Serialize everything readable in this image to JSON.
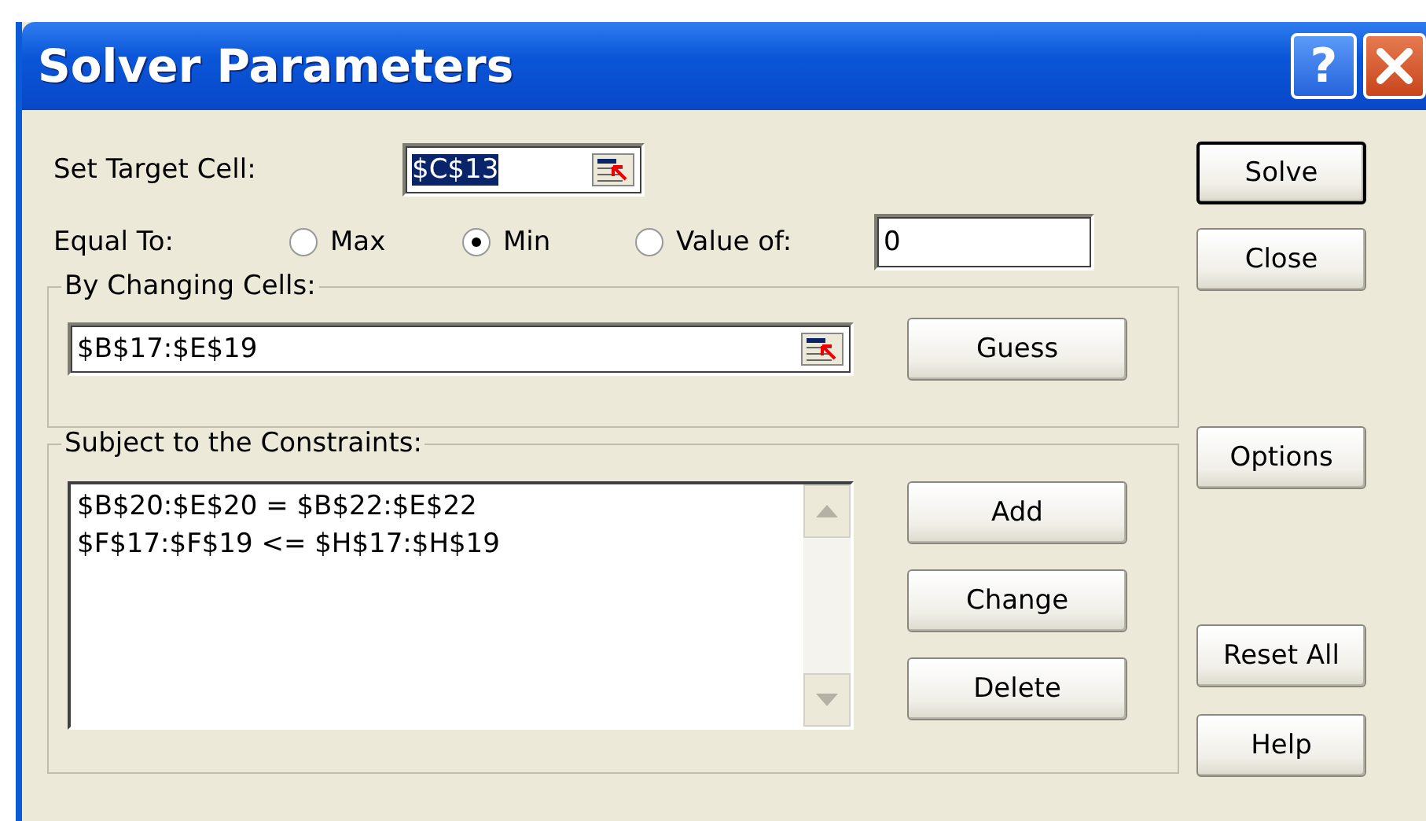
{
  "window": {
    "title": "Solver Parameters",
    "title_buttons": [
      {
        "kind": "help",
        "label": "?"
      },
      {
        "kind": "close"
      }
    ]
  },
  "target_cell": {
    "label": "Set Target Cell:",
    "value": "$C$13"
  },
  "equal_to": {
    "label": "Equal To:",
    "options": [
      {
        "label": "Max",
        "selected": false
      },
      {
        "label": "Min",
        "selected": true
      },
      {
        "label": "Value of:",
        "selected": false
      }
    ],
    "value_of": "0"
  },
  "changing_cells": {
    "group_label": "By Changing Cells:",
    "value": "$B$17:$E$19",
    "button": "Guess"
  },
  "constraints": {
    "group_label": "Subject to the Constraints:",
    "items": [
      "$B$20:$E$20 = $B$22:$E$22",
      "$F$17:$F$19 <= $H$17:$H$19"
    ],
    "buttons": [
      "Add",
      "Change",
      "Delete"
    ]
  },
  "side_buttons": [
    {
      "label": "Solve",
      "default": true
    },
    {
      "label": "Close",
      "default": false
    },
    {
      "label": "Options",
      "default": false
    },
    {
      "label": "Reset All",
      "default": false
    },
    {
      "label": "Help",
      "default": false
    }
  ]
}
